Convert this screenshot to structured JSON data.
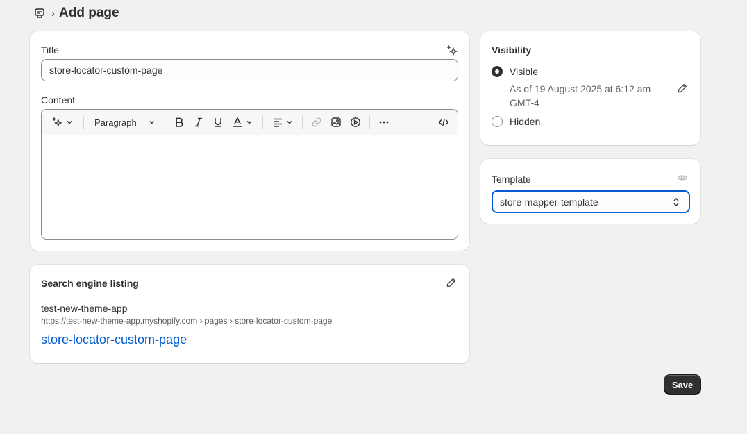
{
  "header": {
    "title": "Add page",
    "breadcrumb_icon": "pages-icon",
    "separator": "›"
  },
  "main": {
    "title_label": "Title",
    "title_value": "store-locator-custom-page",
    "content_label": "Content",
    "toolbar": {
      "magic_icon": "magic-sparkle-icon",
      "paragraph_label": "Paragraph",
      "items": [
        "bold-icon",
        "italic-icon",
        "underline-icon",
        "text-color-icon",
        "align-icon",
        "link-icon",
        "image-icon",
        "video-icon",
        "more-icon",
        "code-icon"
      ]
    }
  },
  "seo": {
    "title": "Search engine listing",
    "store_name": "test-new-theme-app",
    "url": "https://test-new-theme-app.myshopify.com › pages › store-locator-custom-page",
    "link_title": "store-locator-custom-page"
  },
  "visibility": {
    "title": "Visibility",
    "options": [
      {
        "label": "Visible",
        "checked": true
      },
      {
        "label": "Hidden",
        "checked": false
      }
    ],
    "date_text": "As of 19 August 2025 at 6:12 am GMT-4"
  },
  "template": {
    "label": "Template",
    "selected": "store-mapper-template"
  },
  "actions": {
    "save_label": "Save"
  },
  "colors": {
    "link": "#005bd3",
    "primary_button": "#303030",
    "focus_ring": "#005bd3"
  }
}
